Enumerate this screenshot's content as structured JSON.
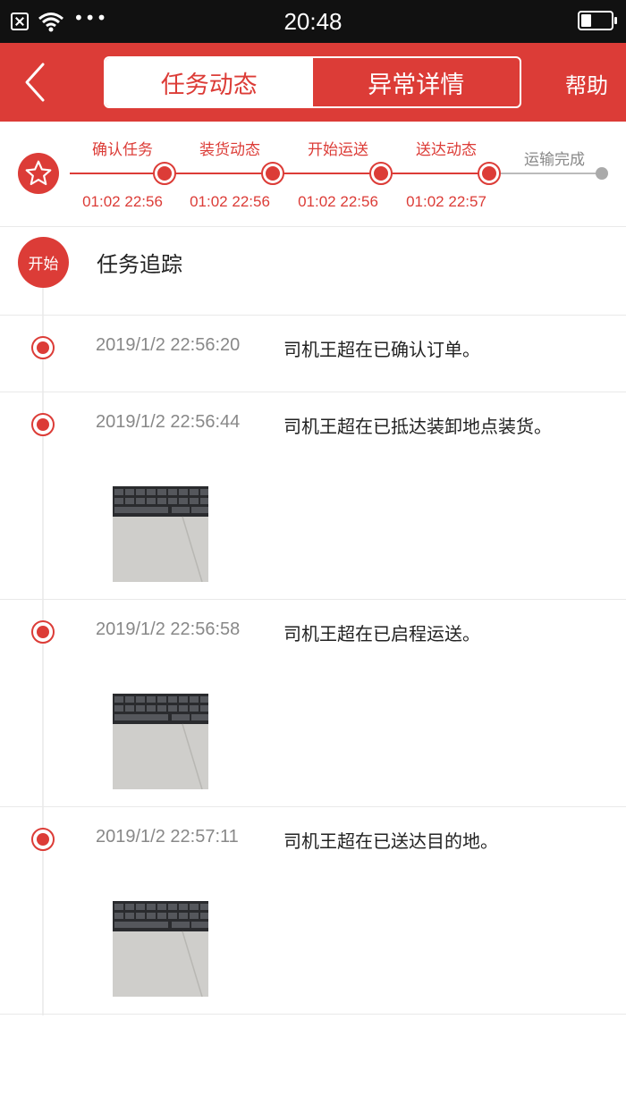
{
  "status_bar": {
    "time": "20:48",
    "dots": "•••",
    "battery_level": 0.35
  },
  "header": {
    "back_icon": "chevron-left-icon",
    "tabs": [
      {
        "label": "任务动态",
        "active": true
      },
      {
        "label": "异常详情",
        "active": false
      }
    ],
    "help_label": "帮助"
  },
  "progress": {
    "icon": "star-icon",
    "steps": [
      {
        "label": "确认任务",
        "time": "01:02 22:56"
      },
      {
        "label": "装货动态",
        "time": "01:02 22:56"
      },
      {
        "label": "开始运送",
        "time": "01:02 22:56"
      },
      {
        "label": "送达动态",
        "time": "01:02 22:57"
      }
    ],
    "final_label": "运输完成"
  },
  "tracking": {
    "badge": "开始",
    "title": "任务追踪",
    "events": [
      {
        "time": "2019/1/2 22:56:20",
        "text": "司机王超在已确认订单。",
        "has_photo": false
      },
      {
        "time": "2019/1/2 22:56:44",
        "text": "司机王超在已抵达装卸地点装货。",
        "has_photo": true
      },
      {
        "time": "2019/1/2 22:56:58",
        "text": "司机王超在已启程运送。",
        "has_photo": true
      },
      {
        "time": "2019/1/2 22:57:11",
        "text": "司机王超在已送达目的地。",
        "has_photo": true
      }
    ]
  },
  "colors": {
    "brand": "#dc3c37",
    "muted": "#888888"
  }
}
